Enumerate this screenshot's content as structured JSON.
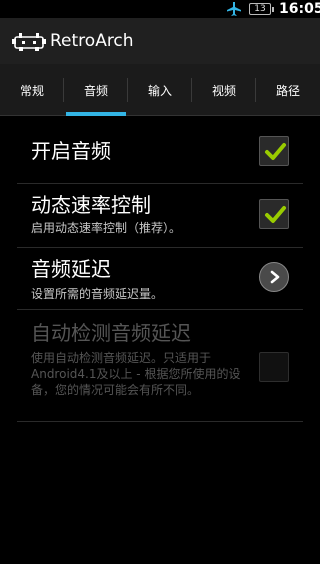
{
  "status_bar": {
    "battery": "13",
    "time": "16:05"
  },
  "app": {
    "title": "RetroArch"
  },
  "tabs": [
    {
      "label": "常规",
      "active": false
    },
    {
      "label": "音频",
      "active": true
    },
    {
      "label": "输入",
      "active": false
    },
    {
      "label": "视频",
      "active": false
    },
    {
      "label": "路径",
      "active": false
    }
  ],
  "preferences": [
    {
      "title": "开启音频",
      "summary": "",
      "control": "checkbox",
      "checked": true,
      "enabled": true
    },
    {
      "title": "动态速率控制",
      "summary": "启用动态速率控制（推荐）。",
      "control": "checkbox",
      "checked": true,
      "enabled": true
    },
    {
      "title": "音频延迟",
      "summary": "设置所需的音频延迟量。",
      "control": "chevron",
      "enabled": true
    },
    {
      "title": "自动检测音频延迟",
      "summary": "使用自动检测音频延迟。只适用于Android4.1及以上 - 根据您所使用的设备，您的情况可能会有所不同。",
      "control": "checkbox",
      "checked": false,
      "enabled": false
    }
  ],
  "colors": {
    "accent": "#33b5e5",
    "check": "#99cc00"
  }
}
